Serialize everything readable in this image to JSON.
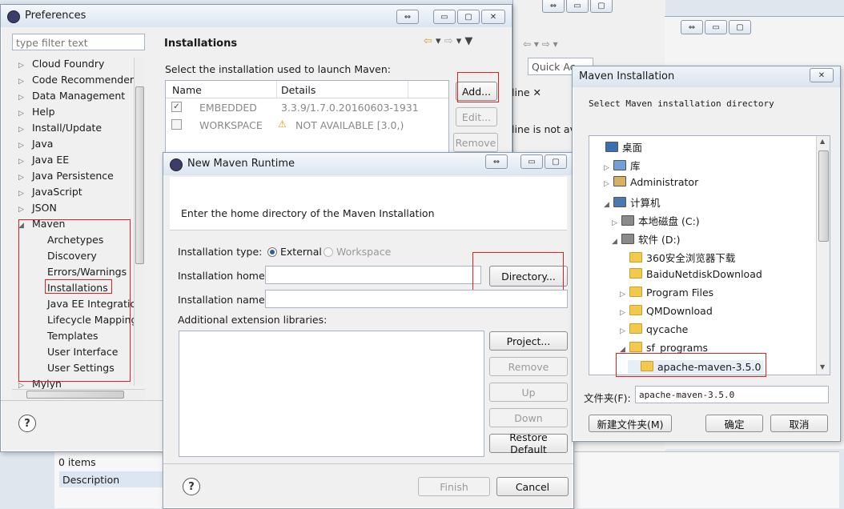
{
  "preferences": {
    "title": "Preferences",
    "filter_placeholder": "type filter text",
    "tree": [
      "Cloud Foundry",
      "Code Recommenders",
      "Data Management",
      "Help",
      "Install/Update",
      "Java",
      "Java EE",
      "Java Persistence",
      "JavaScript",
      "JSON",
      "Maven",
      "Archetypes",
      "Discovery",
      "Errors/Warnings",
      "Installations",
      "Java EE Integration",
      "Lifecycle Mapping",
      "Templates",
      "User Interface",
      "User Settings",
      "Mylyn"
    ],
    "page_title": "Installations",
    "instruction": "Select the installation used to launch Maven:",
    "columns": [
      "Name",
      "Details"
    ],
    "rows": [
      {
        "name": "EMBEDDED",
        "details": "3.3.9/1.7.0.20160603-1931",
        "checked": true
      },
      {
        "name": "WORKSPACE",
        "details": "NOT AVAILABLE [3.0,)",
        "checked": false
      }
    ],
    "buttons": {
      "add": "Add...",
      "edit": "Edit...",
      "remove": "Remove"
    }
  },
  "background": {
    "quick_access": "Quick Ac",
    "outline_tab": "line",
    "outline_msg": "line is not ava",
    "items_count": "0 items",
    "description_col": "Description"
  },
  "maven_runtime": {
    "title": "New Maven Runtime",
    "header": "Enter the home directory of the Maven Installation",
    "installation_type_label": "Installation type:",
    "external": "External",
    "workspace": "Workspace",
    "home_label": "Installation home:",
    "name_label": "Installation name:",
    "ext_libs_label": "Additional extension libraries:",
    "directory_btn": "Directory...",
    "project_btn": "Project...",
    "remove_btn": "Remove",
    "up_btn": "Up",
    "down_btn": "Down",
    "restore_btn": "Restore Default",
    "finish_btn": "Finish",
    "cancel_btn": "Cancel"
  },
  "folder_dialog": {
    "title": "Maven Installation",
    "prompt": "Select Maven installation directory",
    "tree": [
      "桌面",
      "库",
      "Administrator",
      "计算机",
      "本地磁盘 (C:)",
      "软件 (D:)",
      "360安全浏览器下载",
      "BaiduNetdiskDownload",
      "Program Files",
      "QMDownload",
      "qycache",
      "sf_programs",
      "apache-maven-3.5.0"
    ],
    "folder_label": "文件夹(F):",
    "folder_value": "apache-maven-3.5.0",
    "new_folder_btn": "新建文件夹(M)",
    "ok_btn": "确定",
    "cancel_btn": "取消"
  }
}
